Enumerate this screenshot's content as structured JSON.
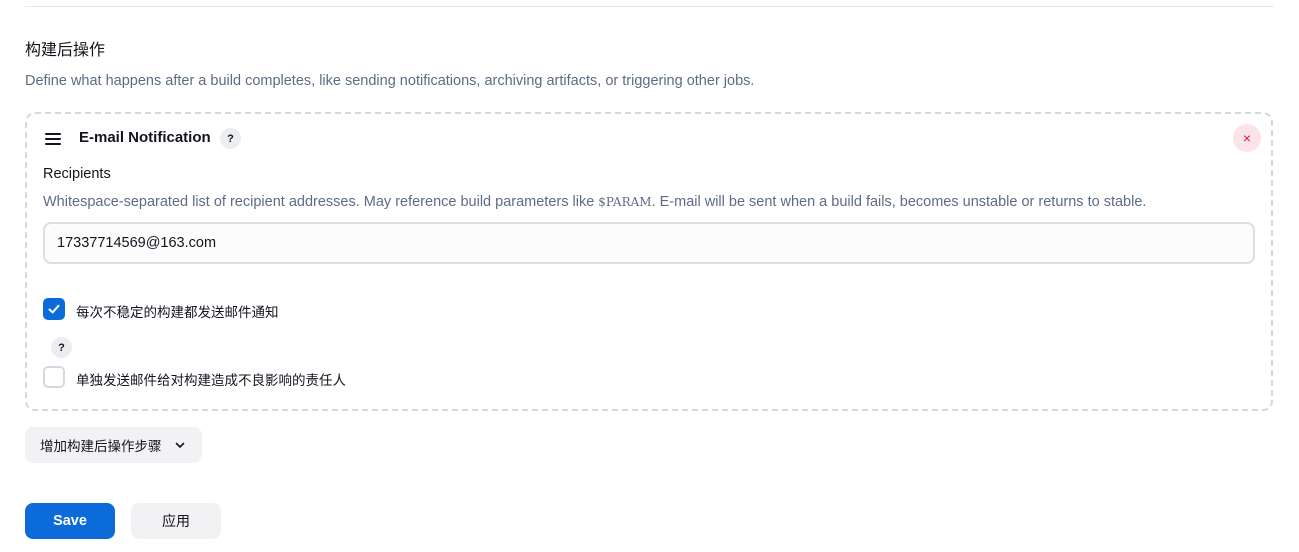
{
  "section": {
    "title": "构建后操作",
    "description": "Define what happens after a build completes, like sending notifications, archiving artifacts, or triggering other jobs."
  },
  "step": {
    "title": "E-mail Notification",
    "help_icon": "?",
    "remove_icon": "×",
    "recipients": {
      "label": "Recipients",
      "description_before": "Whitespace-separated list of recipient addresses. May reference build parameters like ",
      "description_code": "$PARAM",
      "description_after": ". E-mail will be sent when a build fails, becomes unstable or returns to stable.",
      "value": "17337714569@163.com"
    },
    "options": [
      {
        "label": "每次不稳定的构建都发送邮件通知",
        "checked": true
      },
      {
        "label": "单独发送邮件给对构建造成不良影响的责任人",
        "checked": false,
        "help_icon": "?"
      }
    ]
  },
  "add_step_button": "增加构建后操作步骤",
  "buttons": {
    "save": "Save",
    "apply": "应用"
  },
  "colors": {
    "primary": "#0b6bd8",
    "danger": "#e0123e",
    "muted_text": "#5c6c86"
  },
  "icons": [
    "drag-handle-icon",
    "help-icon",
    "close-icon",
    "checkmark-icon",
    "chevron-down-icon"
  ]
}
